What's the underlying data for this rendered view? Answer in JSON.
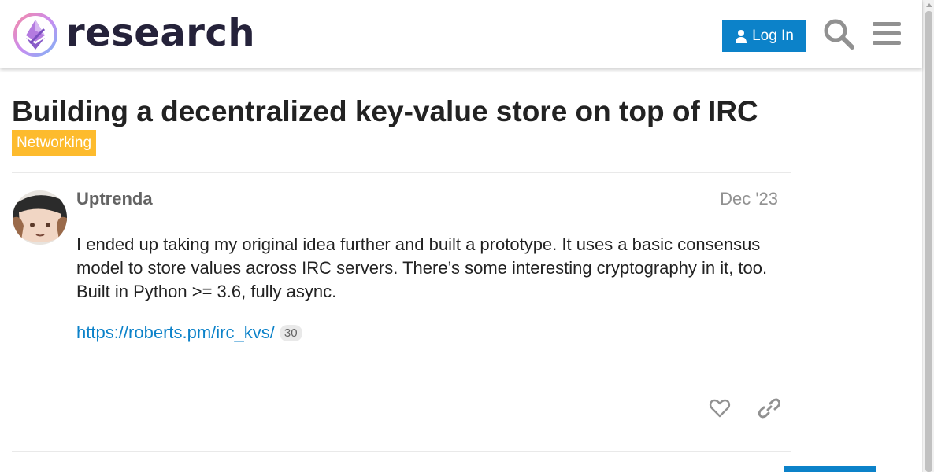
{
  "header": {
    "site_name": "research",
    "login_label": "Log In",
    "icons": {
      "logo": "ethereum-research-logo",
      "login": "user-icon",
      "search": "search-icon",
      "menu": "hamburger-menu-icon"
    },
    "colors": {
      "primary": "#0c82c9",
      "wordmark": "#25223a"
    }
  },
  "topic": {
    "title": "Building a decentralized key-value store on top of IRC",
    "category": "Networking",
    "category_color": "#fdbb2d"
  },
  "post": {
    "author": "Uptrenda",
    "date": "Dec '23",
    "body": "I ended up taking my original idea further and built a prototype. It uses a basic consensus model to store values across IRC servers. There’s some interesting cryptography in it, too. Built in Python >= 3.6, fully async.",
    "link_text": "https://roberts.pm/irc_kvs/",
    "link_clicks": "30",
    "actions": {
      "like": "heart-icon",
      "share": "link-icon"
    }
  }
}
